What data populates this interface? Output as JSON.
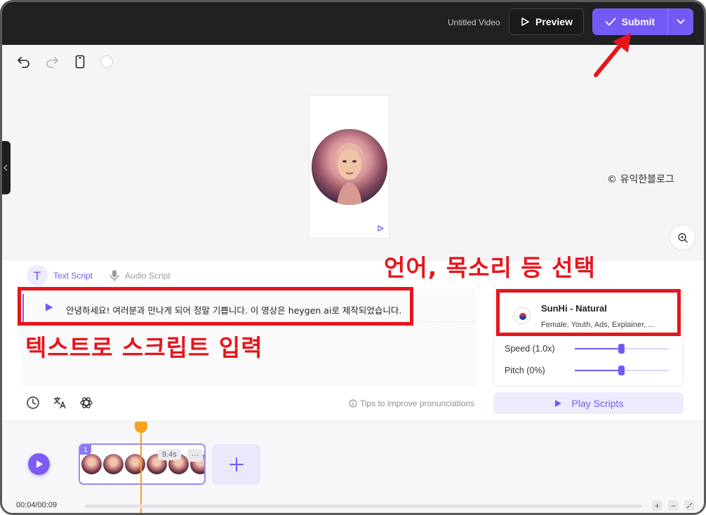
{
  "topbar": {
    "video_title": "Untitled Video",
    "preview_label": "Preview",
    "submit_label": "Submit"
  },
  "canvas": {
    "watermark": "© 유익한블로그"
  },
  "script_panel": {
    "tabs": [
      {
        "label": "Text Script",
        "active": true
      },
      {
        "label": "Audio Script",
        "active": false
      }
    ],
    "script_text": "안녕하세요! 여러분과 만나게 되어 정말 기쁩니다. 이 영상은 heygen ai로 제작되었습니다.",
    "tips": "Tips to improve pronunciations"
  },
  "voice": {
    "name": "SunHi - Natural",
    "tags": "Female, Youth, Ads, Explainer, ...",
    "speed_label": "Speed (1.0x)",
    "speed_value": 0.5,
    "pitch_label": "Pitch (0%)",
    "pitch_value": 0.5,
    "play_scripts_label": "Play Scripts"
  },
  "timeline": {
    "clip_number": "1",
    "clip_duration": "9.4s",
    "clip_more": "···",
    "time": "00:04/00:09"
  },
  "annotations": {
    "voice_select": "언어, 목소리 등 선택",
    "text_input": "텍스트로 스크립트 입력"
  },
  "colors": {
    "accent": "#7559f5",
    "annotation_red": "#e8141b",
    "playhead": "#f7a021"
  }
}
